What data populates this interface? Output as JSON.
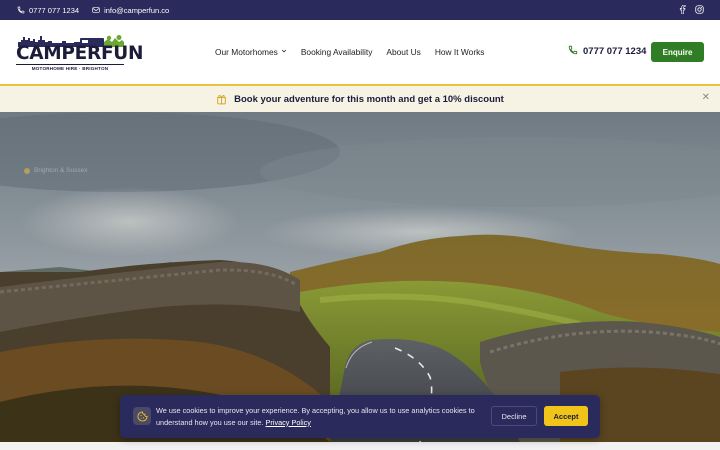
{
  "topbar": {
    "phone": "0777 077 1234",
    "email": "info@camperfun.co",
    "social": [
      "facebook-icon",
      "instagram-icon"
    ]
  },
  "header": {
    "logo": {
      "wordmark": "CAMPERFUN",
      "tagline": "MOTORHOME HIRE · BRIGHTON"
    },
    "nav": [
      {
        "label": "Our Motorhomes",
        "has_dropdown": true
      },
      {
        "label": "Booking Availability",
        "has_dropdown": false
      },
      {
        "label": "About Us",
        "has_dropdown": false
      },
      {
        "label": "How It Works",
        "has_dropdown": false
      }
    ],
    "phone": "0777 077 1234",
    "cta": "Enquire"
  },
  "promo": {
    "text": "Book your adventure for this month and get a 10% discount",
    "icon": "gift-icon"
  },
  "hero": {
    "badge": "Brighton & Sussex"
  },
  "cookie": {
    "text": "We use cookies to improve your experience. By accepting, you allow us to use analytics cookies to understand how you use our site.",
    "link": "Privacy Policy",
    "decline": "Decline",
    "accept": "Accept"
  },
  "colors": {
    "navy": "#2b2a5c",
    "green": "#2f7d24",
    "yellow": "#f0c419",
    "promo_bg": "#f7f3e4"
  }
}
